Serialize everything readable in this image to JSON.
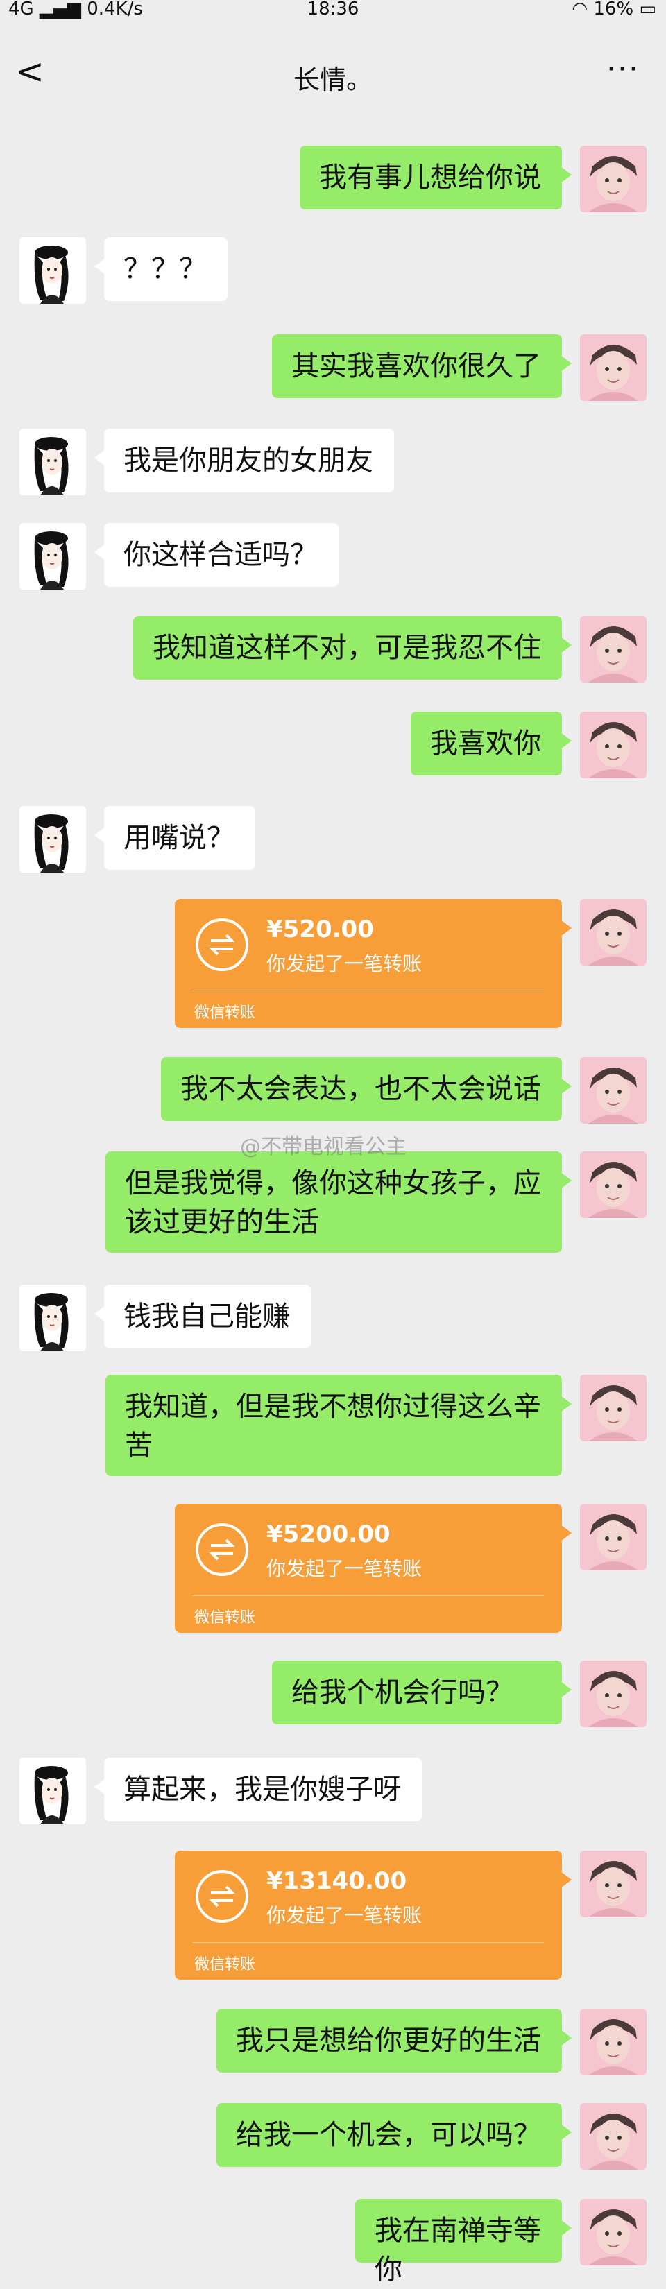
{
  "status_bar": {
    "signal": "4G",
    "speed": "0.4K/s",
    "time": "18:36",
    "battery": "16%"
  },
  "header": {
    "back_icon": "chevron-left-icon",
    "title": "长情。",
    "more_icon": "more-dots-icon"
  },
  "messages": [
    {
      "side": "right",
      "type": "text",
      "text": "我有事儿想给你说"
    },
    {
      "side": "left",
      "type": "text",
      "text": "？？？"
    },
    {
      "side": "right",
      "type": "text",
      "text": "其实我喜欢你很久了"
    },
    {
      "side": "left",
      "type": "text",
      "text": "我是你朋友的女朋友"
    },
    {
      "side": "left",
      "type": "text",
      "text": "你这样合适吗？"
    },
    {
      "side": "right",
      "type": "text",
      "text": "我知道这样不对，可是我忍不住"
    },
    {
      "side": "right",
      "type": "text",
      "text": "我喜欢你"
    },
    {
      "side": "left",
      "type": "text",
      "text": "用嘴说？"
    },
    {
      "side": "right",
      "type": "transfer",
      "amount": "¥520.00",
      "desc": "你发起了一笔转账",
      "label": "微信转账"
    },
    {
      "side": "right",
      "type": "text",
      "text": "我不太会表达，也不太会说话"
    },
    {
      "side": "right",
      "type": "text",
      "text": "但是我觉得，像你这种女孩子，应该过更好的生活"
    },
    {
      "side": "left",
      "type": "text",
      "text": "钱我自己能赚"
    },
    {
      "side": "right",
      "type": "text",
      "text": "我知道，但是我不想你过得这么辛苦"
    },
    {
      "side": "right",
      "type": "transfer",
      "amount": "¥5200.00",
      "desc": "你发起了一笔转账",
      "label": "微信转账"
    },
    {
      "side": "right",
      "type": "text",
      "text": "给我个机会行吗？"
    },
    {
      "side": "left",
      "type": "text",
      "text": "算起来，我是你嫂子呀"
    },
    {
      "side": "right",
      "type": "transfer",
      "amount": "¥13140.00",
      "desc": "你发起了一笔转账",
      "label": "微信转账"
    },
    {
      "side": "right",
      "type": "text",
      "text": "我只是想给你更好的生活"
    },
    {
      "side": "right",
      "type": "text",
      "text": "给我一个机会，可以吗？"
    },
    {
      "side": "right",
      "type": "text",
      "text": "我在南禅寺等你"
    }
  ],
  "watermark": "@不带电视看公主",
  "colors": {
    "background": "#ededed",
    "own_bubble": "#95ec69",
    "other_bubble": "#ffffff",
    "transfer_card": "#f79e39"
  }
}
